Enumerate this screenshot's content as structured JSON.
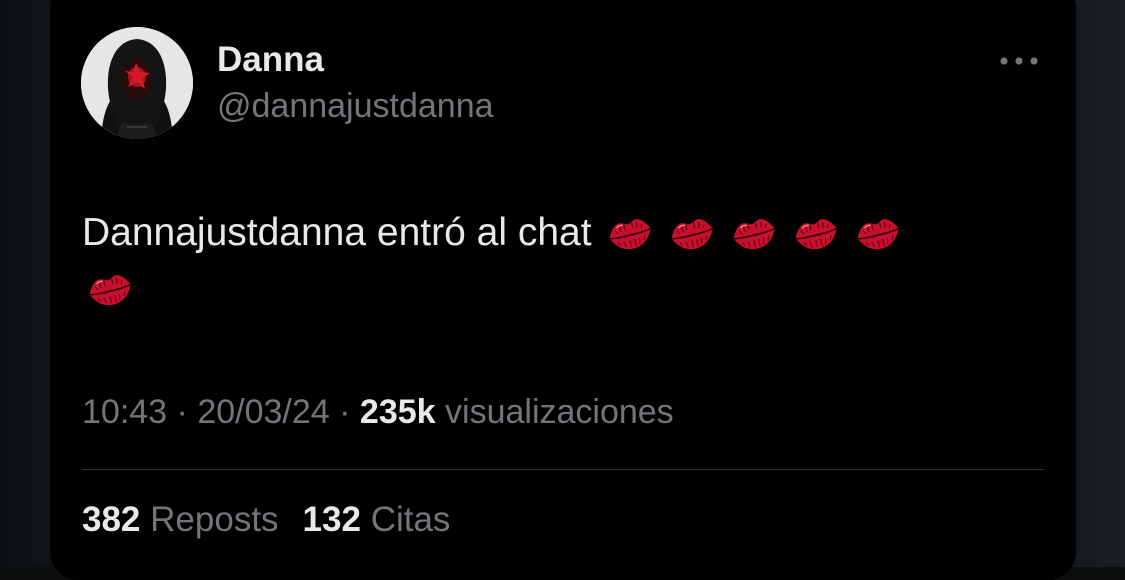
{
  "author": {
    "display_name": "Danna",
    "handle": "@dannajustdanna",
    "avatar_icon": "profile-photo"
  },
  "header": {
    "more_icon": "ellipsis-icon"
  },
  "post": {
    "text": "Dannajustdanna entró al chat",
    "emoji": "kiss-mark",
    "emoji_count": 6
  },
  "meta": {
    "time": "10:43",
    "separator": "·",
    "date": "20/03/24",
    "views_count": "235k",
    "views_label": "visualizaciones"
  },
  "stats": {
    "reposts_count": "382",
    "reposts_label": "Reposts",
    "quotes_count": "132",
    "quotes_label": "Citas"
  },
  "colors": {
    "background": "#000000",
    "primary_text": "#e7e9ea",
    "secondary_text": "#71767b",
    "divider": "#2f3336",
    "kiss_red": "#c8102e"
  }
}
